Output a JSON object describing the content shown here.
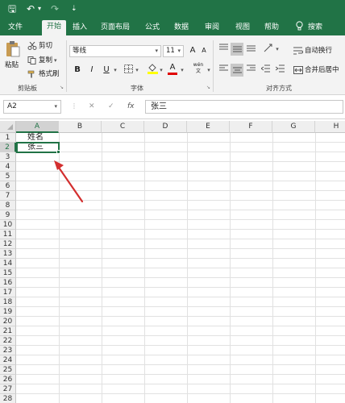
{
  "quick_access": {
    "save": "🖫",
    "undo": "↶",
    "undo_dropdown": "▾",
    "redo": "↷",
    "customize": "⇣"
  },
  "tabs": [
    "文件",
    "开始",
    "插入",
    "页面布局",
    "公式",
    "数据",
    "审阅",
    "视图",
    "帮助"
  ],
  "active_tab": "开始",
  "search_label": "搜索",
  "clipboard": {
    "paste": "粘贴",
    "cut": "剪切",
    "copy": "复制",
    "format_painter": "格式刷",
    "group": "剪贴板"
  },
  "font": {
    "name": "等线",
    "size": "11",
    "grow": "A",
    "shrink": "A",
    "bold": "B",
    "italic": "I",
    "underline": "U",
    "group": "字体",
    "font_color": "A",
    "wen": "wén 文"
  },
  "alignment": {
    "wrap_text": "自动换行",
    "merge_center": "合并后居中",
    "group": "对齐方式"
  },
  "formula_bar": {
    "name_box": "A2",
    "cancel": "✕",
    "enter": "✓",
    "fx": "fx",
    "content": "张三"
  },
  "columns": [
    "A",
    "B",
    "C",
    "D",
    "E",
    "F",
    "G",
    "H"
  ],
  "selected_column": "A",
  "rows": [
    "1",
    "2",
    "3",
    "4",
    "5",
    "6",
    "7",
    "8",
    "9",
    "10",
    "11",
    "12",
    "13",
    "14",
    "15",
    "16",
    "17",
    "18",
    "19",
    "20",
    "21",
    "22",
    "23",
    "24",
    "25",
    "26",
    "27",
    "28"
  ],
  "selected_row": "2",
  "cells": {
    "A1": "姓名",
    "A2": "张三"
  },
  "accent_color": "#217346",
  "annotation_arrow_color": "#d32f2f"
}
